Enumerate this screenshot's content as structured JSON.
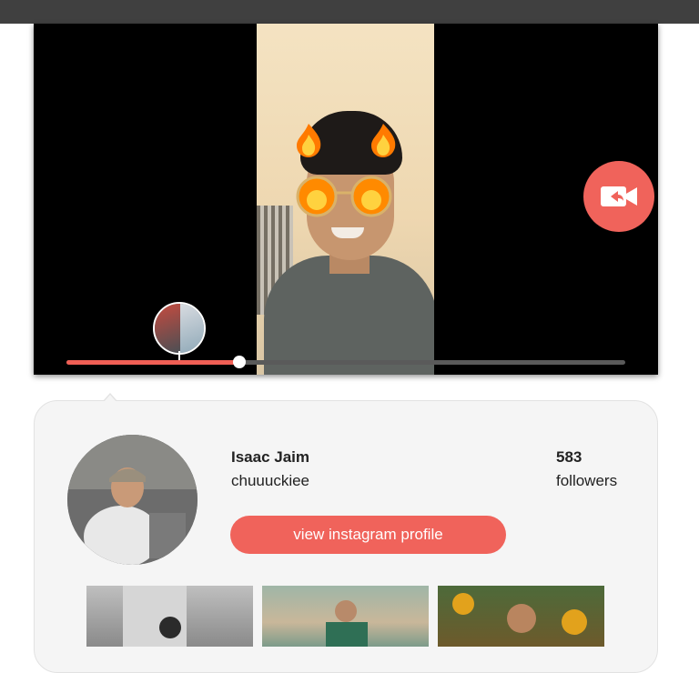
{
  "colors": {
    "accent": "#f0635b",
    "progress_track": "#5a5a5a",
    "card_bg": "#f5f5f5"
  },
  "video": {
    "progress_fraction": 0.31,
    "call_button_icon": "video-call-icon"
  },
  "profile": {
    "name": "Isaac Jaim",
    "username": "chuuuckiee",
    "followers_count": "583",
    "followers_label": "followers",
    "button_label": "view instagram profile"
  },
  "photos": [
    {
      "icon": "photo-thumbnail"
    },
    {
      "icon": "photo-thumbnail"
    },
    {
      "icon": "photo-thumbnail"
    }
  ]
}
